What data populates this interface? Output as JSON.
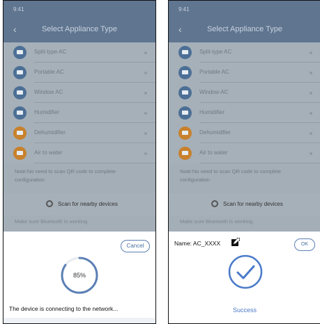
{
  "statusbar": {
    "time": "9:41"
  },
  "navbar": {
    "title": "Select Appliance Type",
    "back_icon": "chevron-left-icon"
  },
  "appliances": [
    {
      "label": "Split-type AC",
      "icon": "split-ac-icon",
      "color": "#4c6f95"
    },
    {
      "label": "Portable AC",
      "icon": "portable-ac-icon",
      "color": "#4c6f95"
    },
    {
      "label": "Window AC",
      "icon": "window-ac-icon",
      "color": "#4c6f95"
    },
    {
      "label": "Humidifier",
      "icon": "humidifier-icon",
      "color": "#4c6f95"
    },
    {
      "label": "Dehumidifier",
      "icon": "dehumidifier-icon",
      "color": "#c8812c"
    },
    {
      "label": "Air to water",
      "icon": "air-to-water-icon",
      "color": "#c8812c"
    }
  ],
  "note": "Note:No need to scan QR code to complete configuration",
  "scan": {
    "label": "Scan for nearby devices",
    "icon": "bluetooth-scan-icon"
  },
  "hint": "Make sure Bluetooth is working.",
  "left_dialog": {
    "cancel_label": "Cancel",
    "progress_text": "85%",
    "progress_value": 0.85,
    "message": "The device is connecting to the network..."
  },
  "right_dialog": {
    "name_label": "Name: AC_XXXX",
    "ok_label": "OK",
    "status": "Success",
    "accent": "#4a7ac8"
  }
}
